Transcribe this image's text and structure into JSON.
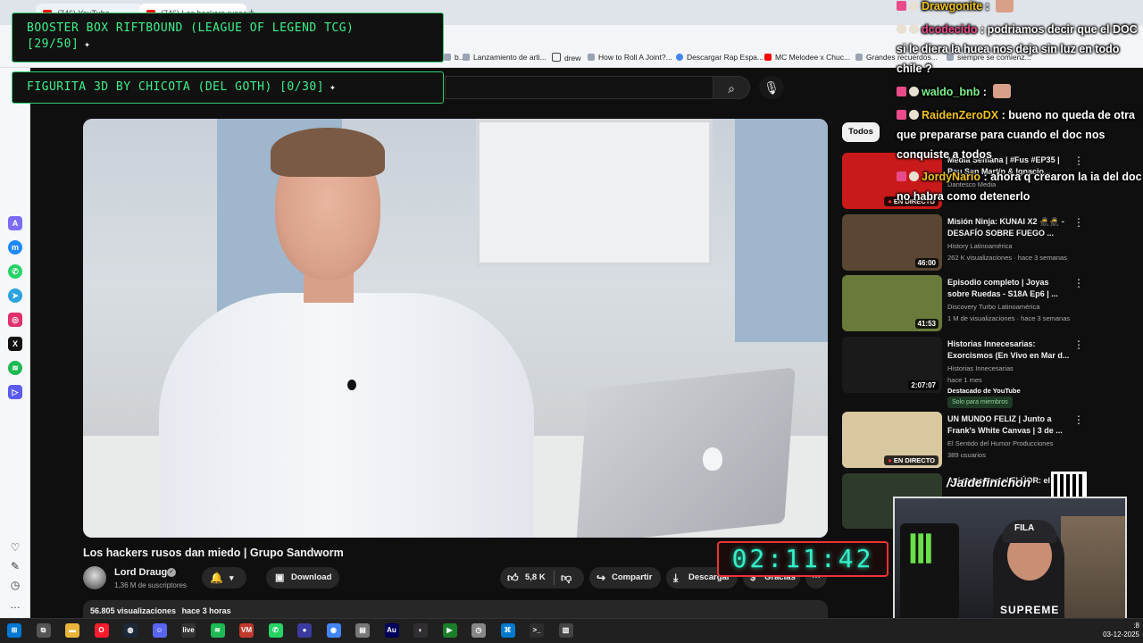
{
  "browser": {
    "tabs": [
      {
        "label": "(746) YouTube"
      },
      {
        "label": "(746) Los hackers rusos"
      }
    ],
    "new_tab": "+",
    "bookmarks": [
      {
        "label": "b...",
        "kind": "page"
      },
      {
        "label": "Lanzamiento de arti...",
        "kind": "page"
      },
      {
        "label": "drew",
        "kind": "folder"
      },
      {
        "label": "How to Roll A Joint?...",
        "kind": "page"
      },
      {
        "label": "Descargar Rap Espa...",
        "kind": "g"
      },
      {
        "label": "MC Melodee x Chuc...",
        "kind": "yt"
      },
      {
        "label": "Grandes recuerdos...",
        "kind": "page"
      },
      {
        "label": "siempre se comienz...",
        "kind": "page"
      }
    ]
  },
  "overlay": {
    "goal1": {
      "text": "BOOSTER BOX RIFTBOUND (LEAGUE OF LEGEND TCG)",
      "progress": "[29/50]"
    },
    "goal2": {
      "text": "FIGURITA 3D BY CHICOTA (DEL GOTH)",
      "progress": "[0/30]"
    },
    "timer": "02:11:42",
    "handle": "/Jaidefinichon",
    "chat": [
      {
        "user": "Drawgonite",
        "user_color": "#f0c419",
        "message": ""
      },
      {
        "user": "dcodecido",
        "user_color": "#e94b8a",
        "message": "podriamos decir que el DOC si le diera la huea nos deja sin luz en todo chile ?"
      },
      {
        "user": "waldo_bnb",
        "user_color": "#7df08b",
        "message": ""
      },
      {
        "user": "RaidenZeroDX",
        "user_color": "#f0c419",
        "message": "bueno no queda de otra que prepararse para cuando el doc nos conquiste a todos"
      },
      {
        "user": "JordyNario",
        "user_color": "#f0c419",
        "message": "ahora q crearon la ia del doc no habra como detenerlo"
      }
    ],
    "cam": {
      "cap_text": "FILA",
      "shirt_text": "SUPREME"
    }
  },
  "video": {
    "title": "Los hackers rusos dan miedo | Grupo Sandworm",
    "channel": "Lord Draugr",
    "subscribers": "1,36 M de suscriptores",
    "download_label": "Download",
    "likes": "5,8 K",
    "share_label": "Compartir",
    "descargar_label": "Descargar",
    "gracias_label": "Gracias",
    "views": "56.805 visualizaciones",
    "age": "hace 3 horas"
  },
  "sidebar_chip": "Todos",
  "recommendations": [
    {
      "title": "Media Semana | #Fus #EP35 | Pau San Martín & Ignacio...",
      "meta1": "Dantesco Media",
      "meta2": "",
      "overlay": "EN DIRECTO",
      "thumb_color": "#c81a1a"
    },
    {
      "title": "Misión Ninja: KUNAI X2 🥷🥷 - DESAFÍO SOBRE FUEGO ...",
      "meta1": "History Latinoamérica",
      "meta2": "262 K visualizaciones · hace 3 semanas",
      "overlay": "46:00",
      "thumb_color": "#5b4634"
    },
    {
      "title": "Episodio completo | Joyas sobre Ruedas - S18A Ep6 | ...",
      "meta1": "Discovery Turbo Latinoamérica",
      "meta2": "1 M de visualizaciones · hace 3 semanas",
      "overlay": "41:53",
      "thumb_color": "#6a7a3a"
    },
    {
      "title": "Historias Innecesarias: Exorcismos (En Vivo en Mar d...",
      "meta1": "Historias Innecesarias",
      "meta2": "hace 1 mes",
      "overlay": "2:07:07",
      "thumb_color": "#1a1a1a",
      "badge": "Destacado de YouTube",
      "member": "Solo para miembros"
    },
    {
      "title": "UN MUNDO FELIZ | Junto a Frank's White Canvas | 3 de ...",
      "meta1": "El Sentido del Humor Producciones",
      "meta2": "389 usuarios",
      "overlay": "EN DIRECTO",
      "thumb_color": "#d9c7a0"
    },
    {
      "title": "Así reacciona el FLÚOR: el",
      "meta1": "",
      "meta2": "",
      "overlay": "",
      "thumb_color": "#2e3b2a"
    }
  ],
  "taskbar": {
    "date": "03-12-2025",
    "time": ":8",
    "apps": [
      "windows",
      "taskview",
      "explorer",
      "opera",
      "steam",
      "discord",
      "live",
      "spotify",
      "voicemeeter",
      "whatsapp",
      "app",
      "chrome",
      "notes",
      "audition",
      "obs",
      "player",
      "clock",
      "vscode",
      "terminal",
      "app2"
    ]
  },
  "colors": {
    "youtube_bg": "#0f0f0f",
    "goal_green": "#3df08b",
    "timer_cyan": "#35f0c9",
    "timer_border": "#e33"
  }
}
